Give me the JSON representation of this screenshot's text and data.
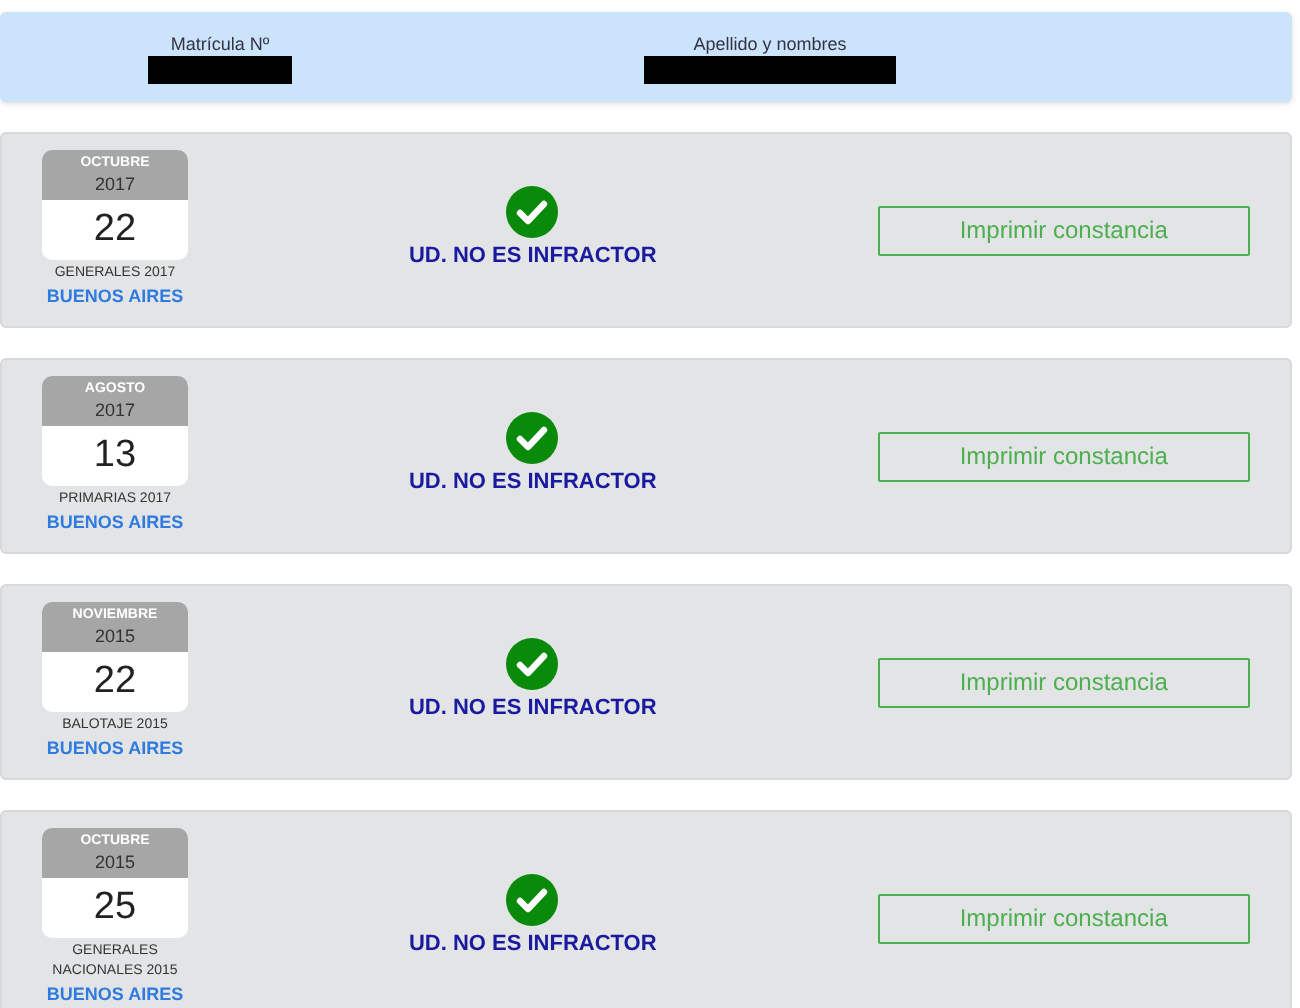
{
  "header": {
    "fields": [
      {
        "label": "Matrícula Nº"
      },
      {
        "label": "Apellido y nombres"
      }
    ]
  },
  "elections": [
    {
      "month": "OCTUBRE",
      "year": "2017",
      "day": "22",
      "name": "GENERALES 2017",
      "district": "BUENOS AIRES",
      "status": {
        "kind": "ok",
        "text": "UD. NO ES INFRACTOR"
      },
      "button": "Imprimir constancia"
    },
    {
      "month": "AGOSTO",
      "year": "2017",
      "day": "13",
      "name": "PRIMARIAS 2017",
      "district": "BUENOS AIRES",
      "status": {
        "kind": "ok",
        "text": "UD. NO ES INFRACTOR"
      },
      "button": "Imprimir constancia"
    },
    {
      "month": "NOVIEMBRE",
      "year": "2015",
      "day": "22",
      "name": "BALOTAJE 2015",
      "district": "BUENOS AIRES",
      "status": {
        "kind": "ok",
        "text": "UD. NO ES INFRACTOR"
      },
      "button": "Imprimir constancia"
    },
    {
      "month": "OCTUBRE",
      "year": "2015",
      "day": "25",
      "name": "GENERALES NACIONALES 2015",
      "district": "BUENOS AIRES",
      "status": {
        "kind": "ok",
        "text": "UD. NO ES INFRACTOR"
      },
      "button": "Imprimir constancia"
    }
  ]
}
